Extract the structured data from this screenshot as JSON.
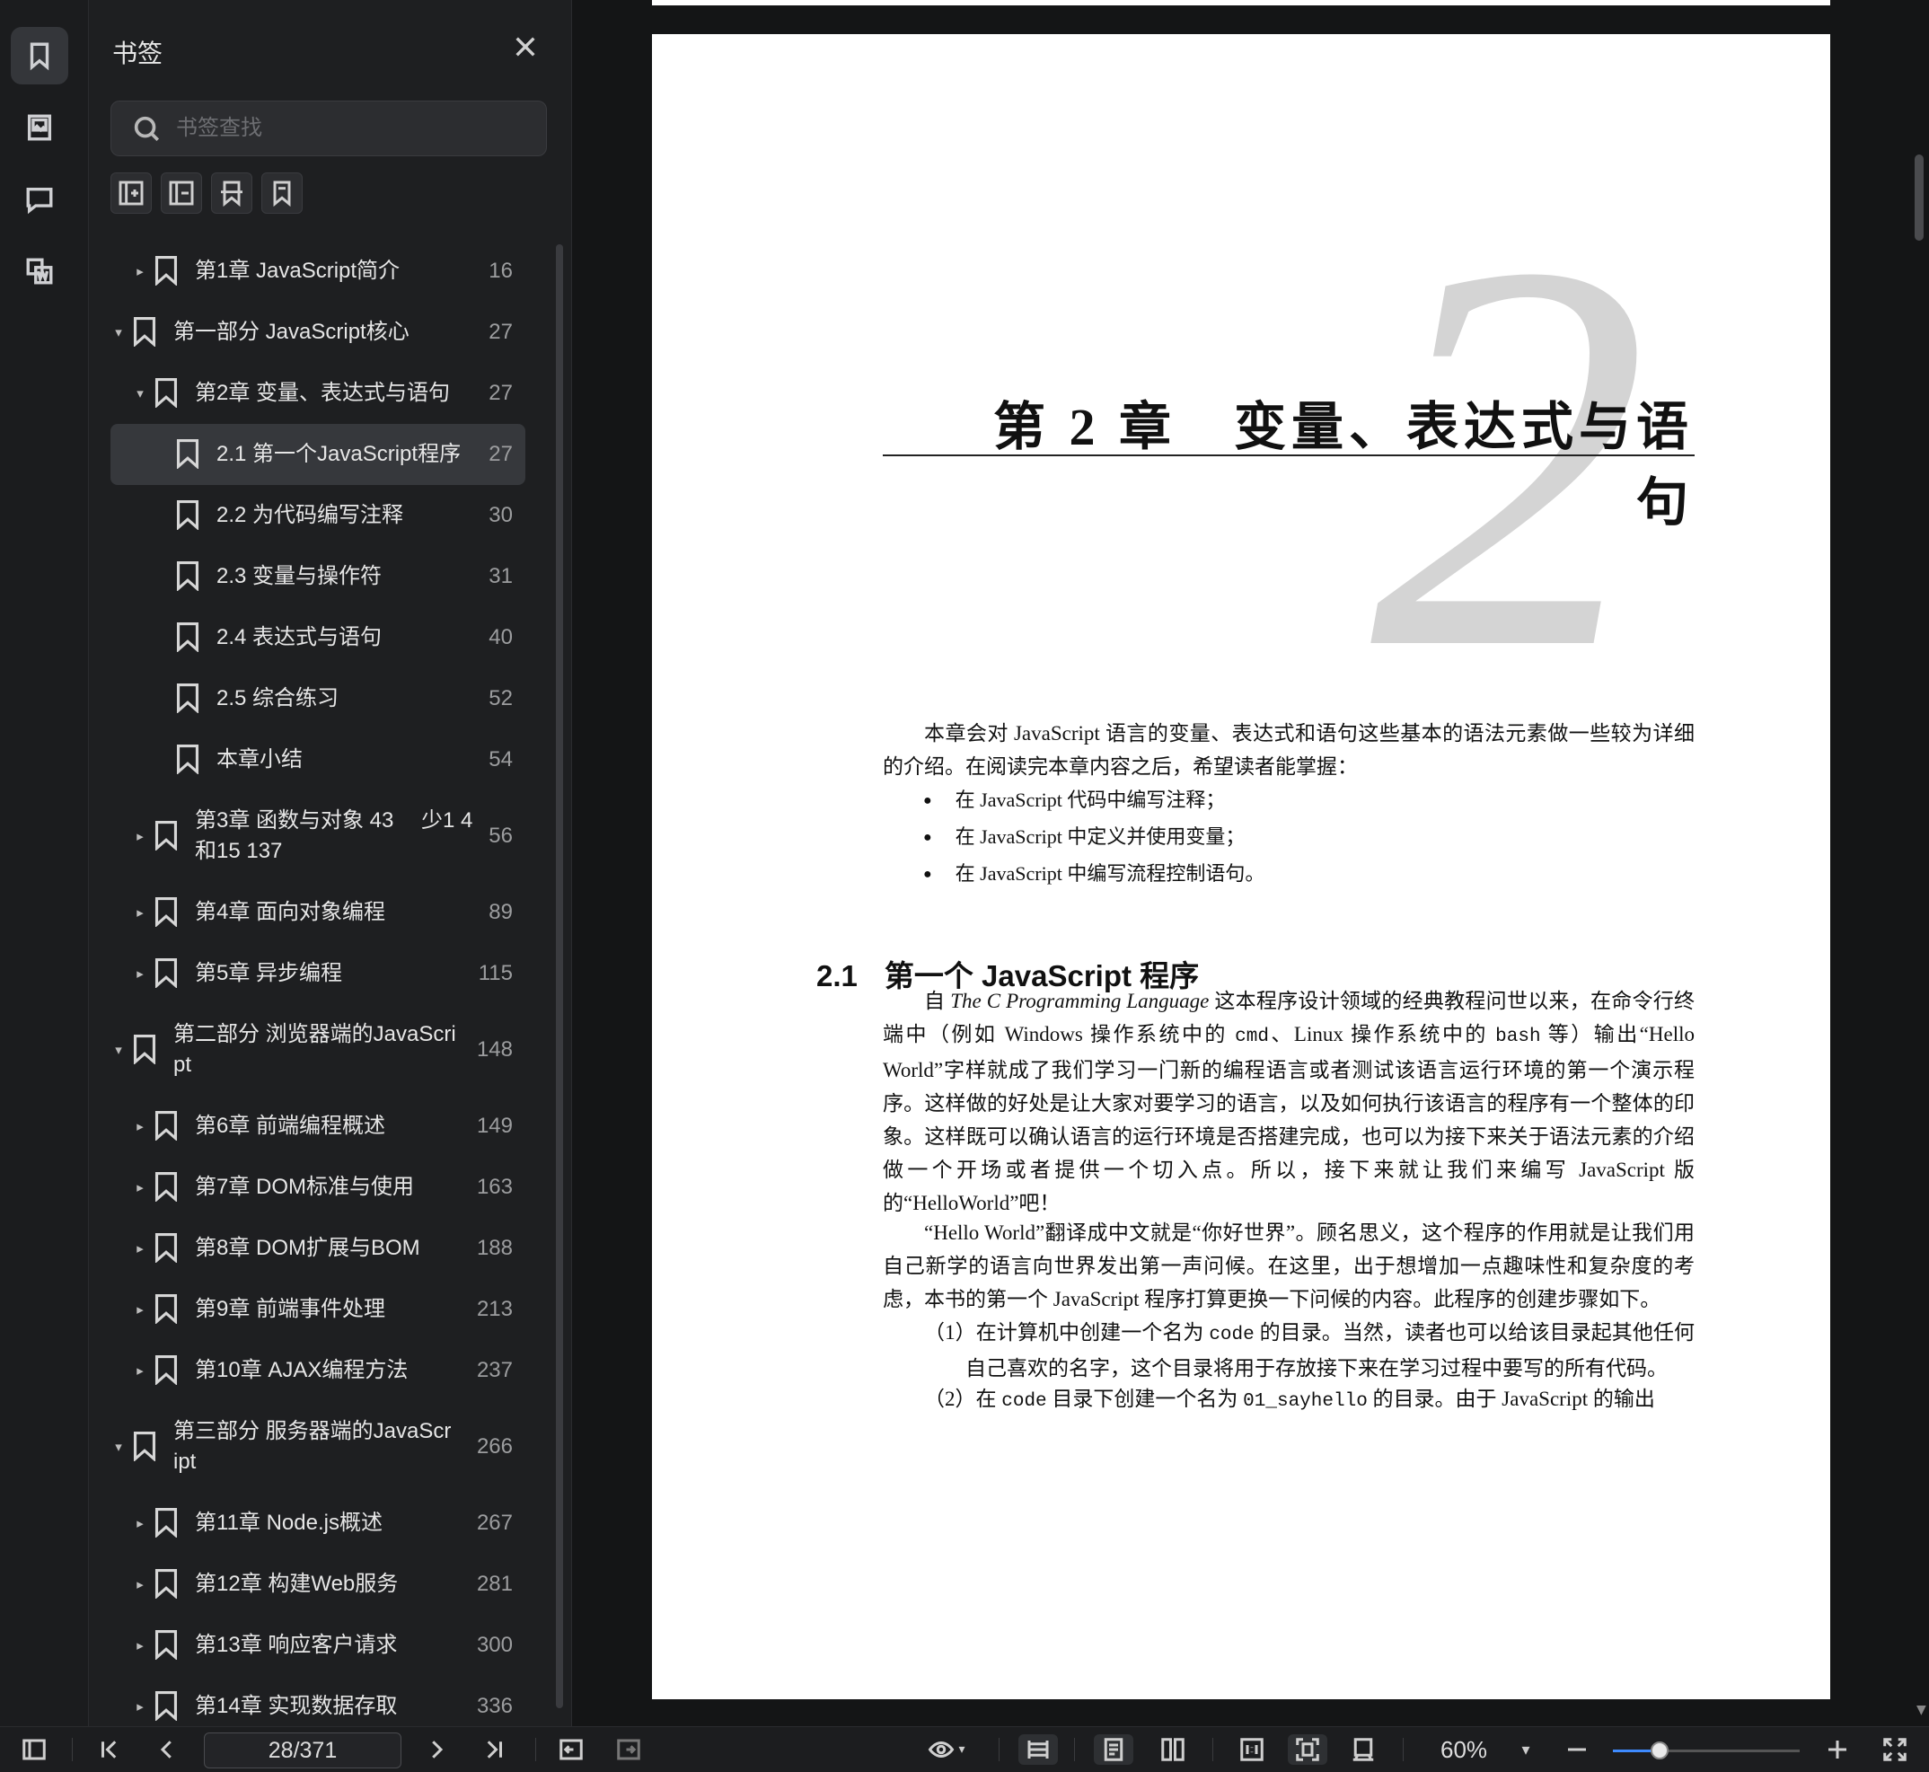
{
  "rail": {
    "items": [
      {
        "name": "bookmark-icon",
        "active": true
      },
      {
        "name": "image-icon",
        "active": false
      },
      {
        "name": "comment-icon",
        "active": false
      },
      {
        "name": "word-convert-icon",
        "active": false
      }
    ]
  },
  "panel": {
    "title": "书签",
    "search_placeholder": "书签查找",
    "tools": [
      "add-bookmark-icon",
      "remove-bookmark-icon",
      "expand-bookmark-icon",
      "bookmark-outline-icon"
    ],
    "bookmarks": [
      {
        "level": 1,
        "caret": "▸",
        "label": "第1章 JavaScript简介",
        "page": "16"
      },
      {
        "level": 0,
        "caret": "▾",
        "label": "第一部分 JavaScript核心",
        "page": "27"
      },
      {
        "level": 1,
        "caret": "▾",
        "label": "第2章 变量、表达式与语句",
        "page": "27"
      },
      {
        "level": 2,
        "caret": "",
        "label": "2.1 第一个JavaScript程序",
        "page": "27",
        "selected": true
      },
      {
        "level": 2,
        "caret": "",
        "label": "2.2 为代码编写注释",
        "page": "30"
      },
      {
        "level": 2,
        "caret": "",
        "label": "2.3 变量与操作符",
        "page": "31"
      },
      {
        "level": 2,
        "caret": "",
        "label": "2.4 表达式与语句",
        "page": "40"
      },
      {
        "level": 2,
        "caret": "",
        "label": "2.5 综合练习",
        "page": "52"
      },
      {
        "level": 2,
        "caret": "",
        "label": "本章小结",
        "page": "54"
      },
      {
        "level": 1,
        "caret": "▸",
        "label": "第3章 函数与对象 43　 少1 4和15 137",
        "page": "56",
        "tall": true
      },
      {
        "level": 1,
        "caret": "▸",
        "label": "第4章 面向对象编程",
        "page": "89"
      },
      {
        "level": 1,
        "caret": "▸",
        "label": "第5章 异步编程",
        "page": "115"
      },
      {
        "level": 0,
        "caret": "▾",
        "label": "第二部分 浏览器端的JavaScri pt",
        "page": "148",
        "tall": true
      },
      {
        "level": 1,
        "caret": "▸",
        "label": "第6章 前端编程概述",
        "page": "149"
      },
      {
        "level": 1,
        "caret": "▸",
        "label": "第7章 DOM标准与使用",
        "page": "163"
      },
      {
        "level": 1,
        "caret": "▸",
        "label": "第8章 DOM扩展与BOM",
        "page": "188"
      },
      {
        "level": 1,
        "caret": "▸",
        "label": "第9章 前端事件处理",
        "page": "213"
      },
      {
        "level": 1,
        "caret": "▸",
        "label": "第10章 AJAX编程方法",
        "page": "237"
      },
      {
        "level": 0,
        "caret": "▾",
        "label": "第三部分 服务器端的JavaScr ipt",
        "page": "266",
        "tall": true
      },
      {
        "level": 1,
        "caret": "▸",
        "label": "第11章 Node.js概述",
        "page": "267"
      },
      {
        "level": 1,
        "caret": "▸",
        "label": "第12章 构建Web服务",
        "page": "281"
      },
      {
        "level": 1,
        "caret": "▸",
        "label": "第13章 响应客户请求",
        "page": "300"
      },
      {
        "level": 1,
        "caret": "▸",
        "label": "第14章 实现数据存取",
        "page": "336"
      }
    ]
  },
  "document": {
    "big_number": "2",
    "chapter_title": "第 2 章　变量、表达式与语句",
    "intro": "本章会对 JavaScript 语言的变量、表达式和语句这些基本的语法元素做一些较为详细的介绍。在阅读完本章内容之后，希望读者能掌握：",
    "bullets": [
      "在 JavaScript 代码中编写注释；",
      "在 JavaScript 中定义并使用变量；",
      "在 JavaScript 中编写流程控制语句。"
    ],
    "section_number": "2.1",
    "section_title": "第一个 JavaScript 程序",
    "p1_a": "自 ",
    "p1_book": "The C Programming Language",
    "p1_b": " 这本程序设计领域的经典教程问世以来，在命令行终端中（例如 Windows 操作系统中的 ",
    "p1_cmd": "cmd",
    "p1_c": "、Linux 操作系统中的 ",
    "p1_bash": "bash",
    "p1_d": " 等）输出“Hello World”字样就成了我们学习一门新的编程语言或者测试该语言运行环境的第一个演示程序。这样做的好处是让大家对要学习的语言，以及如何执行该语言的程序有一个整体的印象。这样既可以确认语言的运行环境是否搭建完成，也可以为接下来关于语法元素的介绍做一个开场或者提供一个切入点。所以，接下来就让我们来编写 JavaScript 版的“HelloWorld”吧！",
    "p2": "“Hello World”翻译成中文就是“你好世界”。顾名思义，这个程序的作用就是让我们用自己新学的语言向世界发出第一声问候。在这里，出于想增加一点趣味性和复杂度的考虑，本书的第一个 JavaScript 程序打算更换一下问候的内容。此程序的创建步骤如下。",
    "step1_a": "（1）在计算机中创建一个名为 ",
    "step1_code": "code",
    "step1_b": " 的目录。当然，读者也可以给该目录起其他任何自己喜欢的名字，这个目录将用于存放接下来在学习过程中要写的所有代码。",
    "step2_a": "（2）在 ",
    "step2_code": "code",
    "step2_b": " 目录下创建一个名为 ",
    "step2_dir": "01_sayhello",
    "step2_c": " 的目录。由于 JavaScript 的输出"
  },
  "bottombar": {
    "page_indicator": "28/371",
    "zoom": "60%",
    "zoom_fraction": 0.25
  }
}
